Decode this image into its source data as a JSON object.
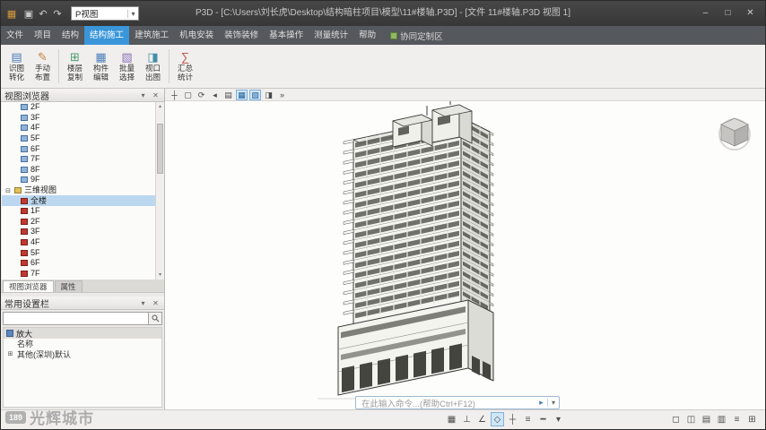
{
  "window": {
    "title": "P3D - [C:\\Users\\刘长虎\\Desktop\\结构暗柱项目\\模型\\11#楼轴.P3D] - [文件 11#楼轴.P3D 视图 1]",
    "minimize": "–",
    "maximize": "□",
    "close": "✕"
  },
  "quick_access": {
    "app_icon": "▦",
    "icons": [
      {
        "name": "save-icon",
        "glyph": "▣"
      },
      {
        "name": "undo-icon",
        "glyph": "↶"
      },
      {
        "name": "redo-icon",
        "glyph": "↷"
      }
    ],
    "workspace_value": "P视图",
    "dropdown_arrow": "▾"
  },
  "ribbon": {
    "tabs": [
      {
        "label": "文件",
        "active": false
      },
      {
        "label": "项目",
        "active": false
      },
      {
        "label": "结构",
        "active": false
      },
      {
        "label": "结构施工",
        "active": true
      },
      {
        "label": "建筑施工",
        "active": false
      },
      {
        "label": "机电安装",
        "active": false
      },
      {
        "label": "装饰装修",
        "active": false
      },
      {
        "label": "基本操作",
        "active": false
      },
      {
        "label": "测量统计",
        "active": false
      },
      {
        "label": "帮助",
        "active": false
      }
    ],
    "right_label": "协同定制区",
    "buttons": [
      {
        "icon": "▤",
        "color": "#4a7ebb",
        "line1": "识图",
        "line2": "转化"
      },
      {
        "icon": "✎",
        "color": "#c07f3a",
        "line1": "手动",
        "line2": "布置"
      },
      {
        "icon": "⊞",
        "color": "#4a9b6e",
        "line1": "楼层",
        "line2": "复制"
      },
      {
        "icon": "▦",
        "color": "#4a7ebb",
        "line1": "构件",
        "line2": "编辑"
      },
      {
        "icon": "▧",
        "color": "#8a6fb8",
        "line1": "批量",
        "line2": "选择"
      },
      {
        "icon": "◨",
        "color": "#3f8fa8",
        "line1": "视口",
        "line2": "出图"
      },
      {
        "icon": "∑",
        "color": "#b85a50",
        "line1": "汇总",
        "line2": "统计"
      }
    ]
  },
  "sidebar": {
    "view_browser": {
      "title": "视图浏览器",
      "collapse_icon": "▾",
      "close_icon": "✕",
      "plan_items": [
        "2F",
        "3F",
        "4F",
        "5F",
        "6F",
        "7F",
        "8F",
        "9F"
      ],
      "group": {
        "expander": "⊟",
        "label": "三维视图"
      },
      "selected_item": "全楼",
      "red_items": [
        "1F",
        "2F",
        "3F",
        "4F",
        "5F",
        "6F",
        "7F"
      ],
      "scroll_up": "▴",
      "scroll_down": "▾"
    },
    "tabs": [
      {
        "label": "视图浏览器",
        "active": true
      },
      {
        "label": "属性",
        "active": false
      }
    ],
    "quick_settings": {
      "title": "常用设置栏",
      "collapse_icon": "▾",
      "close_icon": "✕",
      "search_value": "",
      "header_row": {
        "label": "放大"
      },
      "rows": [
        {
          "label": "名称",
          "indent": 1
        },
        {
          "expander": "⊞",
          "label": "其他(深圳)默认",
          "indent": 0
        }
      ]
    }
  },
  "viewport": {
    "toolbar_icons": [
      {
        "name": "pan-icon",
        "glyph": "┼",
        "active": false
      },
      {
        "name": "zoom-extents-icon",
        "glyph": "▢",
        "active": false
      },
      {
        "name": "orbit-icon",
        "glyph": "⟳",
        "active": false
      },
      {
        "name": "previous-view-icon",
        "glyph": "◂",
        "active": false
      },
      {
        "name": "layout-icon",
        "glyph": "▤",
        "active": false
      },
      {
        "name": "wireframe-style-icon",
        "glyph": "▦",
        "active": true
      },
      {
        "name": "shaded-style-icon",
        "glyph": "▧",
        "active": true
      },
      {
        "name": "section-box-icon",
        "glyph": "◨",
        "active": false
      },
      {
        "name": "more-tools-icon",
        "glyph": "»",
        "active": false
      }
    ],
    "command_bar": {
      "placeholder": "在此输入命令...(帮助Ctrl+F12)",
      "run_icon": "▸",
      "dropdown_icon": "▾"
    }
  },
  "statusbar": {
    "snap_icons": [
      {
        "name": "grid-snap-icon",
        "glyph": "▦",
        "active": false
      },
      {
        "name": "ortho-icon",
        "glyph": "⊥",
        "active": false
      },
      {
        "name": "polar-tracking-icon",
        "glyph": "∠",
        "active": false
      },
      {
        "name": "object-snap-icon",
        "glyph": "◇",
        "active": true
      },
      {
        "name": "crosshair-icon",
        "glyph": "┼",
        "active": false
      },
      {
        "name": "dynamic-input-icon",
        "glyph": "≡",
        "active": false
      },
      {
        "name": "lineweight-icon",
        "glyph": "━",
        "active": false
      },
      {
        "name": "units-dropdown-icon",
        "glyph": "▾",
        "active": false
      }
    ],
    "panel_icons": [
      {
        "name": "layout-single-icon",
        "glyph": "◻"
      },
      {
        "name": "layout-split-icon",
        "glyph": "◫"
      },
      {
        "name": "panel-left-icon",
        "glyph": "▤"
      },
      {
        "name": "panel-bottom-icon",
        "glyph": "▥"
      },
      {
        "name": "list-view-icon",
        "glyph": "≡"
      },
      {
        "name": "grid-view-icon",
        "glyph": "⊞"
      }
    ]
  },
  "watermark": {
    "badge": "189",
    "text": "光辉城市"
  }
}
